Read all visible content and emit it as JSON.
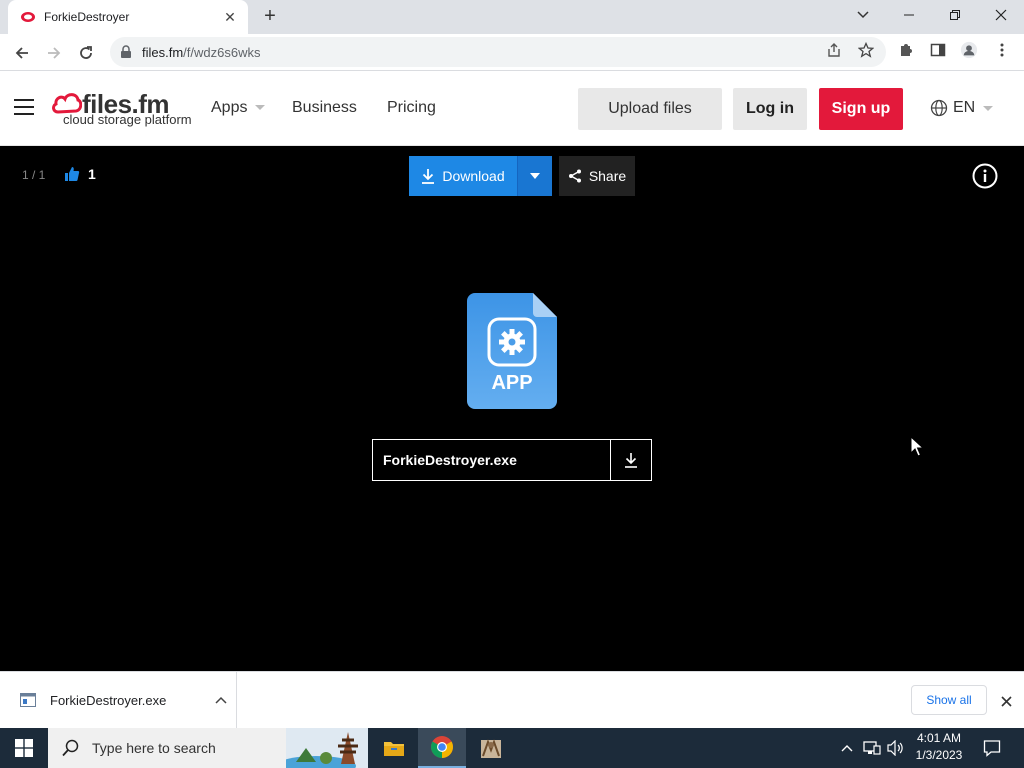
{
  "browser": {
    "tab_title": "ForkieDestroyer",
    "new_tab": "+",
    "url_host": "files.fm",
    "url_path": "/f/wdz6s6wks"
  },
  "site": {
    "logo_name": "files.fm",
    "logo_tagline": "cloud storage platform",
    "nav": {
      "apps": "Apps",
      "business": "Business",
      "pricing": "Pricing"
    },
    "upload_label": "Upload files",
    "login_label": "Log in",
    "signup_label": "Sign up",
    "language": "EN"
  },
  "viewer": {
    "counter": "1 / 1",
    "likes": "1",
    "download_label": "Download",
    "share_label": "Share",
    "file_type_label": "APP",
    "file_name": "ForkieDestroyer.exe"
  },
  "download_shelf": {
    "item_name": "ForkieDestroyer.exe",
    "show_all_label": "Show all"
  },
  "taskbar": {
    "search_placeholder": "Type here to search",
    "time": "4:01 AM",
    "date": "1/3/2023"
  },
  "colors": {
    "brand_red": "#e3193b",
    "download_blue": "#1e88e5",
    "viewer_bg": "#000000",
    "taskbar_bg": "#1c2b3a"
  },
  "icons": [
    "back-icon",
    "forward-icon",
    "reload-icon",
    "lock-icon",
    "share-page-icon",
    "bookmark-star-icon",
    "extensions-icon",
    "side-panel-icon",
    "profile-icon",
    "kebab-menu-icon",
    "globe-icon",
    "thumbs-up-icon",
    "download-icon",
    "share-icon",
    "info-icon",
    "app-file-icon",
    "gear-icon",
    "windows-start-icon",
    "search-icon",
    "file-explorer-icon",
    "chrome-icon",
    "network-icon",
    "volume-icon",
    "notification-icon"
  ]
}
